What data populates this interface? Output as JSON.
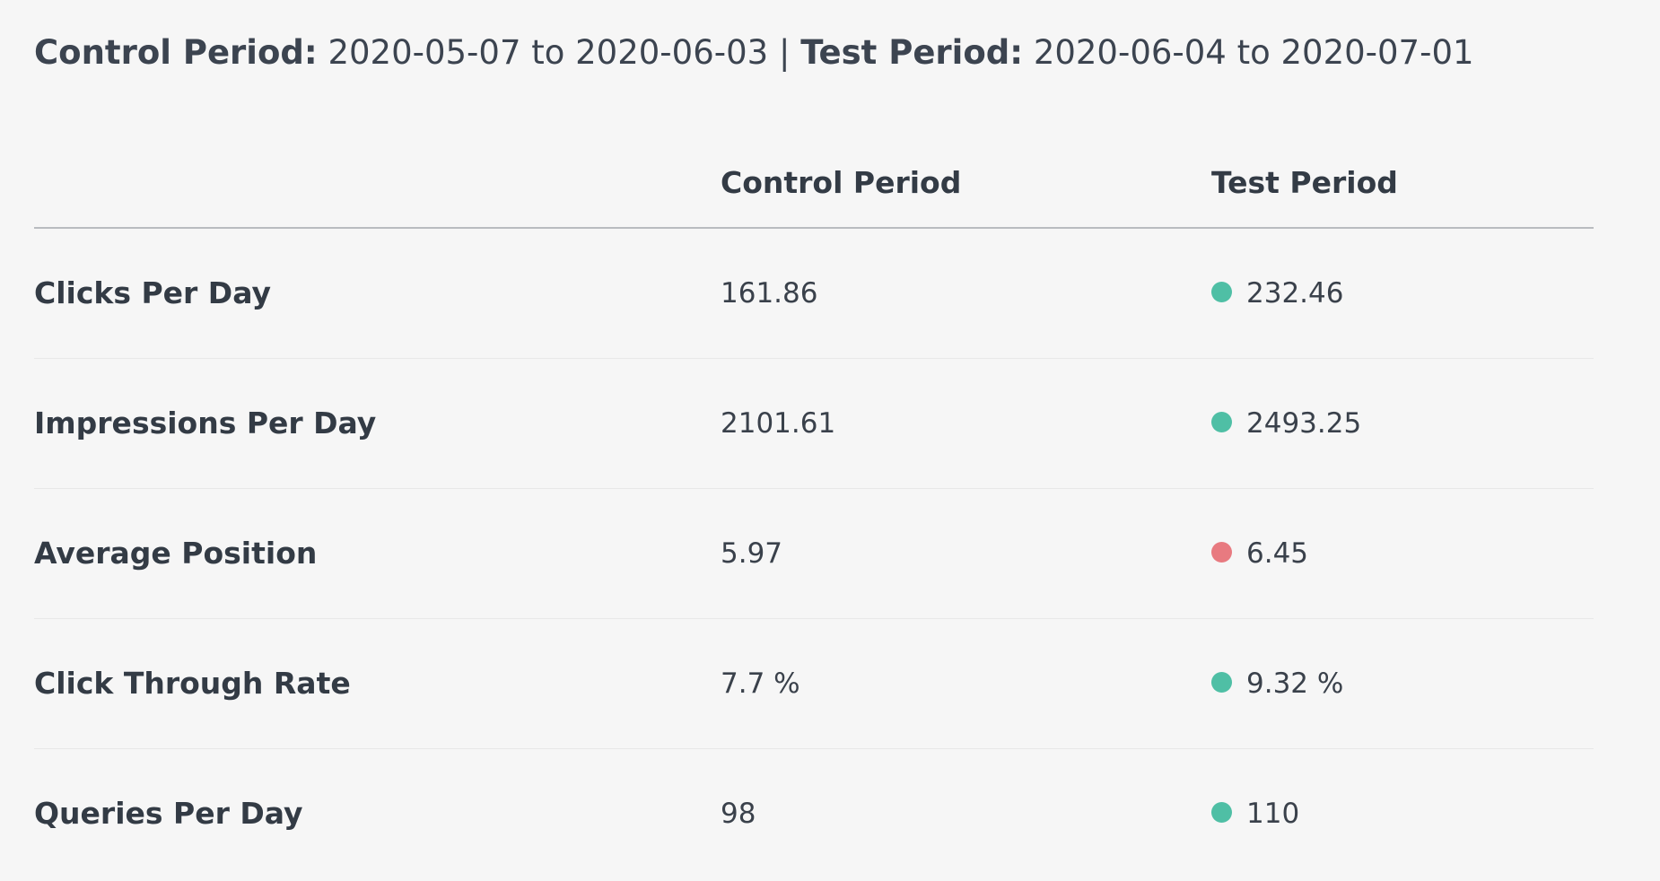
{
  "header": {
    "control_label": "Control Period:",
    "control_range": "2020-05-07 to 2020-06-03",
    "separator": "|",
    "test_label": "Test Period:",
    "test_range": "2020-06-04 to 2020-07-01"
  },
  "table": {
    "columns": [
      "",
      "Control Period",
      "Test Period"
    ],
    "rows": [
      {
        "metric": "Clicks Per Day",
        "control": "161.86",
        "test": "232.46",
        "status": "improved"
      },
      {
        "metric": "Impressions Per Day",
        "control": "2101.61",
        "test": "2493.25",
        "status": "improved"
      },
      {
        "metric": "Average Position",
        "control": "5.97",
        "test": "6.45",
        "status": "declined"
      },
      {
        "metric": "Click Through Rate",
        "control": "7.7 %",
        "test": "9.32 %",
        "status": "improved"
      },
      {
        "metric": "Queries Per Day",
        "control": "98",
        "test": "110",
        "status": "improved"
      }
    ]
  },
  "colors": {
    "improved": "#4fbfa5",
    "declined": "#e87a80"
  }
}
